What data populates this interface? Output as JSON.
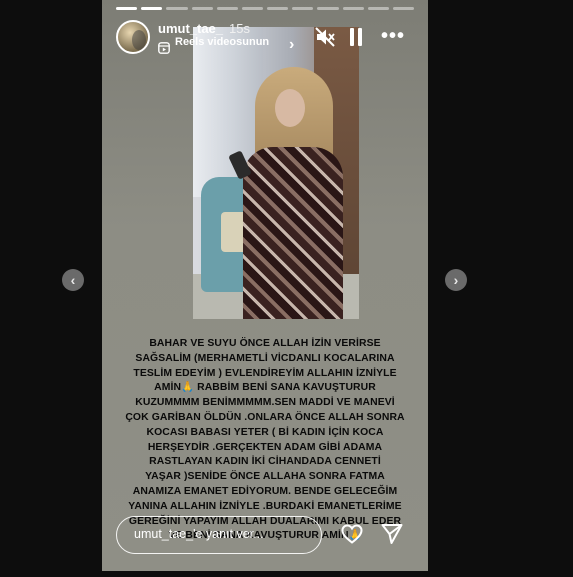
{
  "story": {
    "username": "umut_tae_",
    "time": "15s",
    "reels_label": "Reels videosunun",
    "caption": "BAHAR VE  SUYU  ÖNCE ALLAH İZİN VERİRSE\nSAĞSALİM (MERHAMETLİ VİCDANLI KOCALARINA\nTESLİM EDEYİM ) EVLENDİREYİM ALLAHIN İZNİYLE\nAMİN🙏 RABBİM BENİ SANA KAVUŞTURUR\nKUZUMMMM BENİMMMMM.SEN MADDİ VE MANEVİ\nÇOK GARİBAN  ÖLDÜN .ONLARA ÖNCE ALLAH SONRA\nKOCASI BABASI YETER ( Bİ KADIN İÇİN KOCA\nHERŞEYDİR .GERÇEKTEN ADAM GİBİ ADAMA\nRASTLAYAN KADIN İKİ CİHANDADA CENNETİ\nYAŞAR )SENİDE   ÖNCE ALLAHA  SONRA  FATMA\nANAMIZA  EMANET EDİYORUM. BENDE GELECEĞİM\nYANINA ALLAHIN İZNİYLE .BURDAKİ EMANETLERİME\nGEREĞİNİ YAPAYIM ALLAH DUALARIMI KABUL EDER\nVE BENİ SANA KAVUŞTURUR AMİN🙏",
    "progress_total": 12,
    "progress_done": 2
  },
  "reply": {
    "placeholder": "umut_tae_'e yanıt ver..."
  },
  "nav": {
    "prev": "‹",
    "next": "›"
  },
  "icons": {
    "reels": "reels-icon",
    "mute": "speaker-muted-icon",
    "pause": "pause-icon",
    "more": "more-icon",
    "heart": "heart-icon",
    "send": "send-icon"
  },
  "colors": {
    "background": "#0d0d0d",
    "story_bg": "#8a8a80",
    "caption_text": "#0a0a0a"
  }
}
